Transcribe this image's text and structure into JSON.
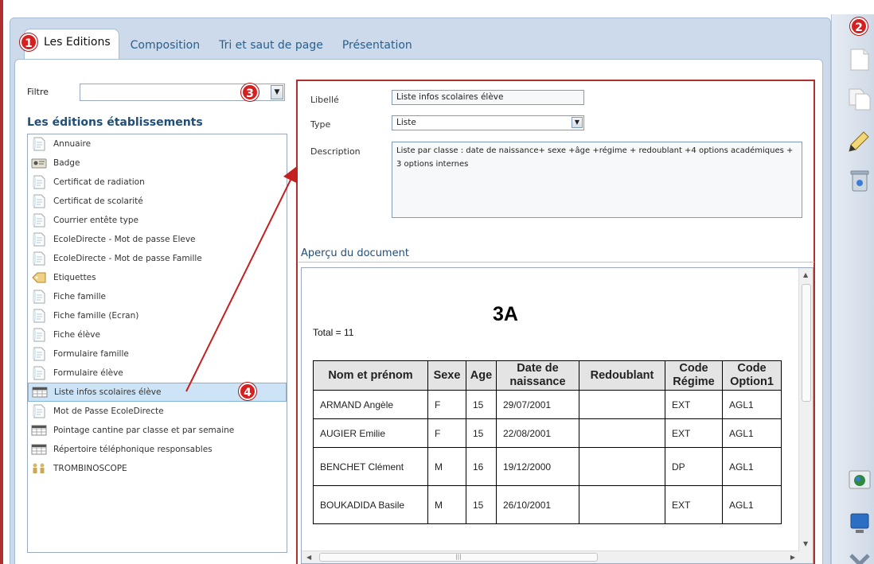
{
  "tabs": [
    "Les Editions",
    "Composition",
    "Tri et saut de page",
    "Présentation"
  ],
  "badges": [
    "1",
    "2",
    "3",
    "4"
  ],
  "filter": {
    "label": "Filtre",
    "value": ""
  },
  "list": {
    "title": "Les éditions établissements",
    "items": [
      {
        "label": "Annuaire",
        "icon": "document-icon"
      },
      {
        "label": "Badge",
        "icon": "badge-icon"
      },
      {
        "label": "Certificat de radiation",
        "icon": "document-icon"
      },
      {
        "label": "Certificat de scolarité",
        "icon": "document-icon"
      },
      {
        "label": "Courrier entête type",
        "icon": "document-icon"
      },
      {
        "label": "EcoleDirecte - Mot de passe Eleve",
        "icon": "document-icon"
      },
      {
        "label": "EcoleDirecte - Mot de passe Famille",
        "icon": "document-icon"
      },
      {
        "label": "Etiquettes",
        "icon": "labels-icon"
      },
      {
        "label": "Fiche famille",
        "icon": "document-icon"
      },
      {
        "label": "Fiche famille (Ecran)",
        "icon": "document-icon"
      },
      {
        "label": "Fiche élève",
        "icon": "document-icon"
      },
      {
        "label": "Formulaire famille",
        "icon": "document-icon"
      },
      {
        "label": "Formulaire élève",
        "icon": "document-icon"
      },
      {
        "label": "Liste infos scolaires élève",
        "icon": "table-icon",
        "selected": true
      },
      {
        "label": "Mot de Passe EcoleDirecte",
        "icon": "document-icon"
      },
      {
        "label": "Pointage cantine par classe et par semaine",
        "icon": "table-icon"
      },
      {
        "label": "Répertoire téléphonique responsables",
        "icon": "table-icon"
      },
      {
        "label": "TROMBINOSCOPE",
        "icon": "people-icon"
      }
    ]
  },
  "details": {
    "libelle_label": "Libellé",
    "libelle_value": "Liste infos scolaires élève",
    "type_label": "Type",
    "type_value": "Liste",
    "description_label": "Description",
    "description_value": "Liste par classe : date de naissance+ sexe +âge +régime + redoublant +4 options académiques + 3 options internes"
  },
  "preview": {
    "title": "Aperçu du document",
    "class_name": "3A",
    "total": "Total = 11",
    "headers": [
      "Nom et prénom",
      "Sexe",
      "Age",
      "Date de naissance",
      "Redoublant",
      "Code Régime",
      "Code Option1"
    ],
    "rows": [
      [
        "ARMAND Angèle",
        "F",
        "15",
        "29/07/2001",
        "",
        "EXT",
        "AGL1"
      ],
      [
        "AUGIER Emilie",
        "F",
        "15",
        "22/08/2001",
        "",
        "EXT",
        "AGL1"
      ],
      [
        "BENCHET Clément",
        "M",
        "16",
        "19/12/2000",
        "",
        "DP",
        "AGL1"
      ],
      [
        "BOUKADIDA Basile",
        "M",
        "15",
        "26/10/2001",
        "",
        "EXT",
        "AGL1"
      ]
    ]
  },
  "toolbar": [
    "new-document-icon",
    "copy-document-icon",
    "edit-pen-icon",
    "delete-bin-icon",
    "web-export-icon",
    "display-icon",
    "close-icon"
  ]
}
